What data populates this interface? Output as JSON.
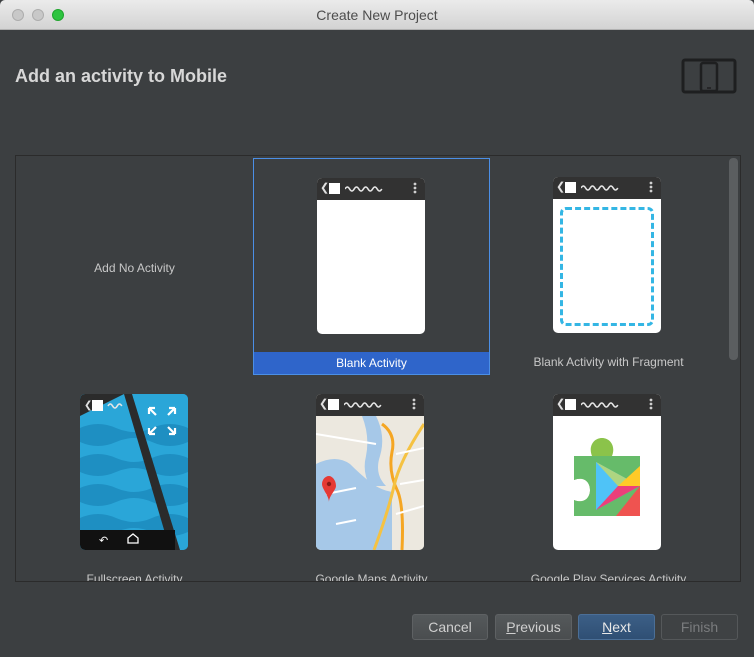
{
  "window": {
    "title": "Create New Project",
    "controls": [
      "close",
      "minimize",
      "zoom"
    ]
  },
  "header": {
    "title": "Add an activity to Mobile",
    "icon": "phone-tablet-device-icon"
  },
  "gallery": {
    "tiles": [
      {
        "label": "Add No Activity",
        "selected": false,
        "preview": "none"
      },
      {
        "label": "Blank Activity",
        "selected": true,
        "preview": "blank-phone"
      },
      {
        "label": "Blank Activity with Fragment",
        "selected": false,
        "preview": "fragment-phone"
      },
      {
        "label": "Fullscreen Activity",
        "selected": false,
        "preview": "fullscreen-phone"
      },
      {
        "label": "Google Maps Activity",
        "selected": false,
        "preview": "maps-phone"
      },
      {
        "label": "Google Play Services Activity",
        "selected": false,
        "preview": "play-services-phone"
      }
    ]
  },
  "footer": {
    "cancel": "Cancel",
    "previous_mnemonic": "P",
    "previous_rest": "revious",
    "next_mnemonic": "N",
    "next_rest": "ext",
    "finish": "Finish"
  },
  "colors": {
    "background": "#3c3f41",
    "selection": "#2f65ca",
    "selection_border": "#4b8fe6",
    "fragment_dash": "#34b6e4",
    "fullscreen_blue": "#2aa6d8"
  }
}
